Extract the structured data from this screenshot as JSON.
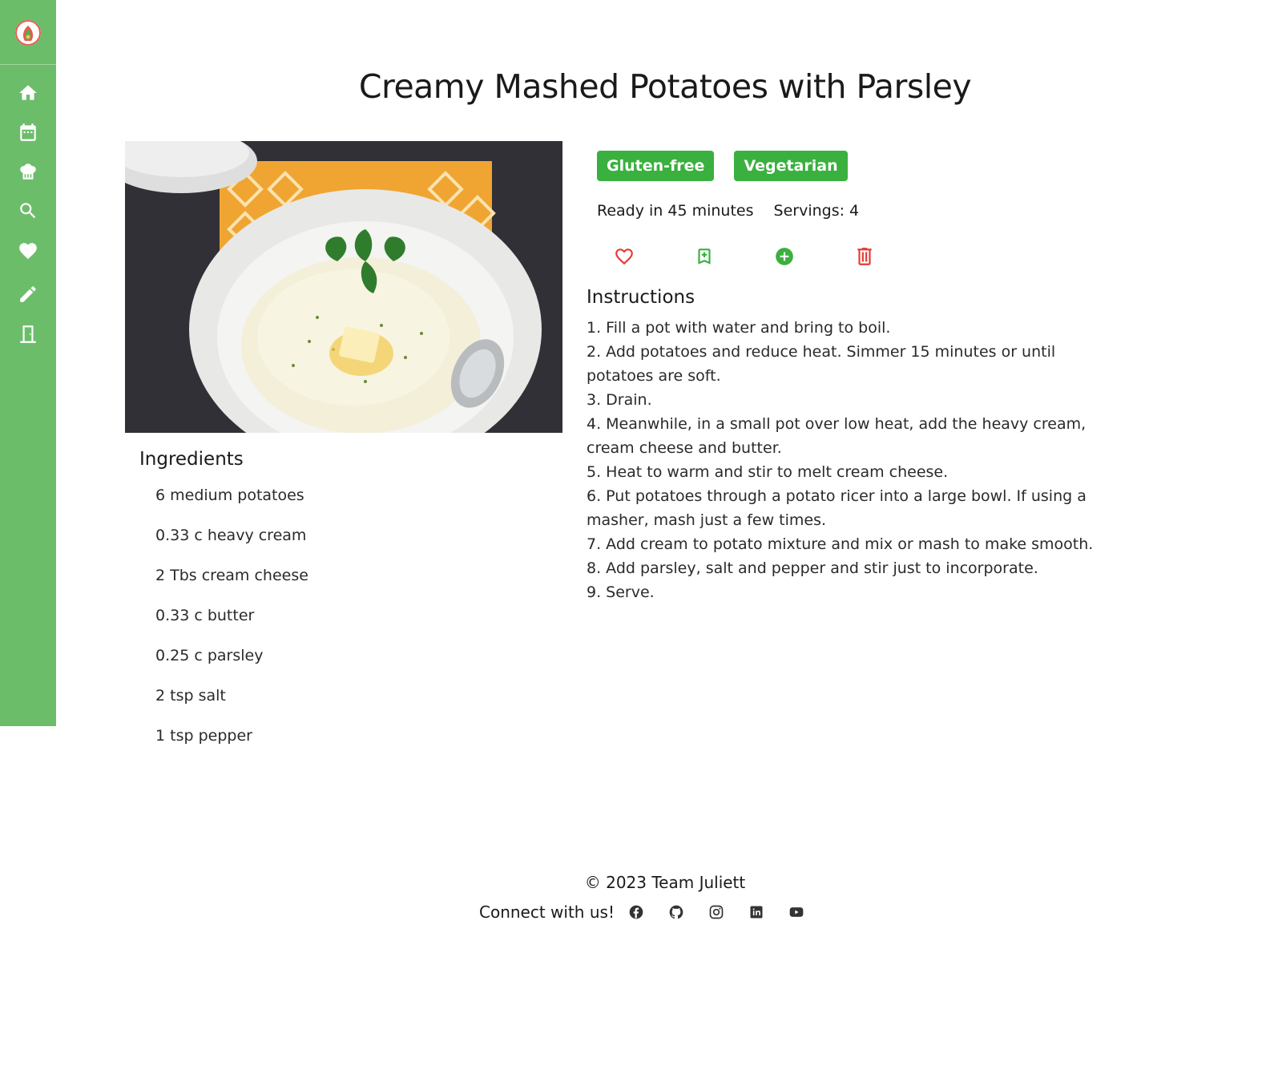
{
  "sidebar": {
    "logo": "app-logo",
    "items": [
      {
        "icon": "home-icon"
      },
      {
        "icon": "calendar-icon"
      },
      {
        "icon": "chef-hat-icon"
      },
      {
        "icon": "search-icon"
      },
      {
        "icon": "heart-icon"
      },
      {
        "icon": "pencil-icon"
      },
      {
        "icon": "door-icon"
      }
    ],
    "color": "#6cbd6a"
  },
  "recipe": {
    "title": "Creamy Mashed Potatoes with Parsley",
    "tags": [
      "Gluten-free",
      "Vegetarian"
    ],
    "ready": "Ready in 45 minutes",
    "servings": "Servings: 4",
    "ingredients_heading": "Ingredients",
    "ingredients": [
      "6 medium potatoes",
      "0.33 c heavy cream",
      "2 Tbs cream cheese",
      "0.33 c butter",
      "0.25 c parsley",
      "2 tsp salt",
      "1 tsp pepper"
    ],
    "instructions_heading": "Instructions",
    "instructions": [
      "1. Fill a pot with water and bring to boil.",
      "2. Add potatoes and reduce heat. Simmer 15 minutes or until potatoes are soft.",
      "3. Drain.",
      "4. Meanwhile, in a small pot over low heat, add the heavy cream, cream cheese and butter.",
      "5. Heat to warm and stir to melt cream cheese.",
      "6. Put potatoes through a potato ricer into a large bowl. If using a masher, mash just a few times.",
      "7. Add cream to potato mixture and mix or mash to make smooth.",
      "8. Add parsley, salt and pepper and stir just to incorporate.",
      "9. Serve."
    ]
  },
  "actions": [
    {
      "icon": "heart-outline-icon",
      "color": "#e53935"
    },
    {
      "icon": "bookmark-add-icon",
      "color": "#3ab03e"
    },
    {
      "icon": "add-circle-icon",
      "color": "#3ab03e"
    },
    {
      "icon": "trash-icon",
      "color": "#e53935"
    }
  ],
  "tag_color": "#3ab03e",
  "footer": {
    "copyright": "© 2023 Team Juliett",
    "connect": "Connect with us!",
    "socials": [
      "facebook-icon",
      "github-icon",
      "instagram-icon",
      "linkedin-icon",
      "youtube-icon"
    ]
  }
}
